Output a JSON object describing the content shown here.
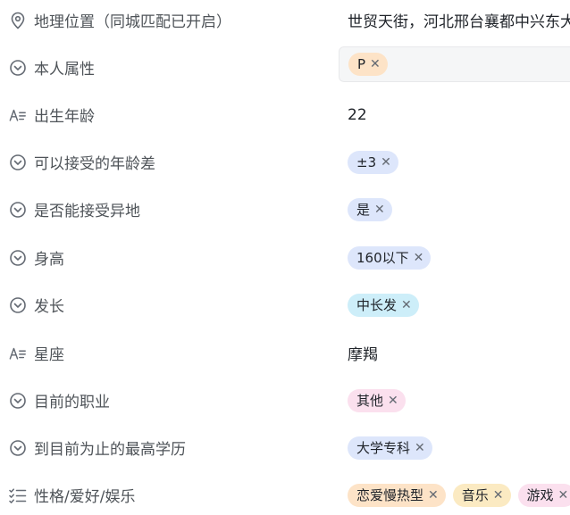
{
  "fields": [
    {
      "label": "地理位置（同城匹配已开启）",
      "icon": "location-icon",
      "value": "世贸天街，河北邢台襄都中兴东大"
    },
    {
      "label": "本人属性",
      "icon": "single-select-icon",
      "tags": [
        {
          "text": "P",
          "color": "#fde3c7"
        }
      ]
    },
    {
      "label": "出生年龄",
      "icon": "text-field-icon",
      "value": "22"
    },
    {
      "label": "可以接受的年龄差",
      "icon": "single-select-icon",
      "tags": [
        {
          "text": "±3",
          "color": "#dde6fb"
        }
      ]
    },
    {
      "label": "是否能接受异地",
      "icon": "single-select-icon",
      "tags": [
        {
          "text": "是",
          "color": "#dde6fb"
        }
      ]
    },
    {
      "label": "身高",
      "icon": "single-select-icon",
      "tags": [
        {
          "text": "160以下",
          "color": "#dde6fb"
        }
      ]
    },
    {
      "label": "发长",
      "icon": "single-select-icon",
      "tags": [
        {
          "text": "中长发",
          "color": "#cdeef9"
        }
      ]
    },
    {
      "label": "星座",
      "icon": "text-field-icon",
      "value": "摩羯"
    },
    {
      "label": "目前的职业",
      "icon": "single-select-icon",
      "tags": [
        {
          "text": "其他",
          "color": "#fbe0ee"
        }
      ]
    },
    {
      "label": "到目前为止的最高学历",
      "icon": "single-select-icon",
      "tags": [
        {
          "text": "大学专科",
          "color": "#dde6fb"
        }
      ]
    },
    {
      "label": "性格/爱好/娱乐",
      "icon": "multi-select-icon",
      "tags": [
        {
          "text": "恋爱慢热型",
          "color": "#fde3c7"
        },
        {
          "text": "音乐",
          "color": "#fbeac2"
        },
        {
          "text": "游戏",
          "color": "#fbe0ee"
        }
      ]
    }
  ],
  "remove_glyph": "✕"
}
